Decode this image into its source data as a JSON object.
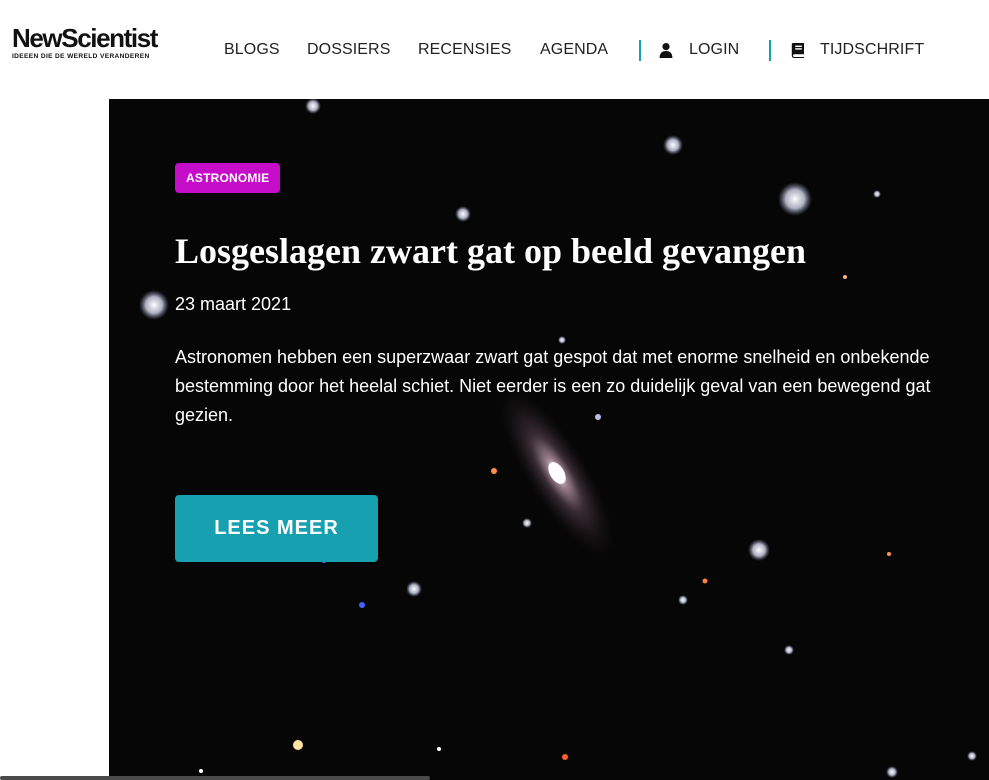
{
  "header": {
    "logo": {
      "name": "NewScientist",
      "tagline": "IDEEEN DIE DE WERELD VERANDEREN"
    },
    "nav": [
      {
        "label": "BLOGS"
      },
      {
        "label": "DOSSIERS"
      },
      {
        "label": "RECENSIES"
      },
      {
        "label": "AGENDA"
      }
    ],
    "login": {
      "label": "LOGIN",
      "icon": "user-icon"
    },
    "magazine": {
      "label": "TIJDSCHRIFT",
      "icon": "book-icon"
    },
    "accent_color": "#16a0b0"
  },
  "hero": {
    "category": "ASTRONOMIE",
    "category_color": "#c50cc8",
    "title": "Losgeslagen zwart gat op beeld gevangen",
    "date": "23 maart 2021",
    "summary": "Astronomen hebben een superzwaar zwart gat gespot dat met enorme snelheid en onbekende bestemming door het heelal schiet. Niet eerder is een zo duidelijk geval van een bewegend gat gezien.",
    "cta_label": "LEES MEER",
    "cta_color": "#16a0b0",
    "background": "galaxy-starfield-image"
  }
}
